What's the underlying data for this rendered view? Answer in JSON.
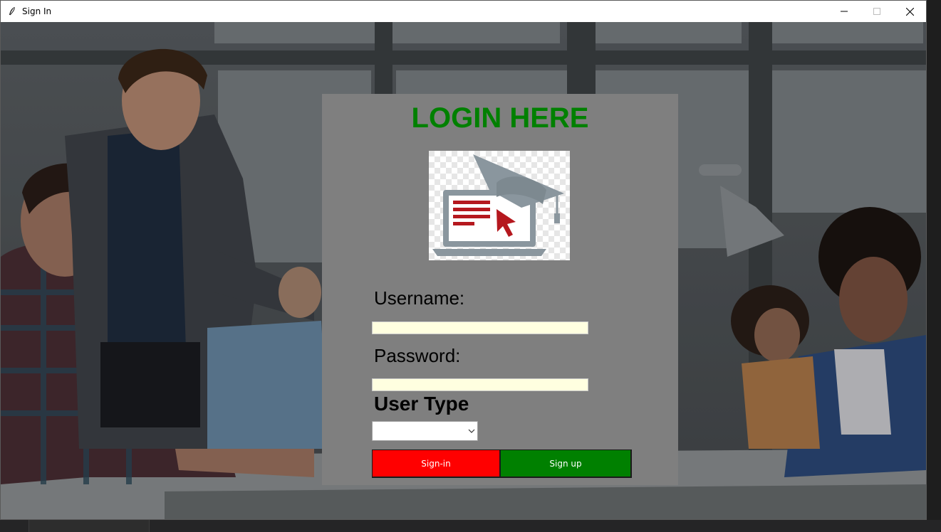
{
  "window": {
    "title": "Sign In"
  },
  "login": {
    "heading": "LOGIN HERE",
    "username_label": "Username:",
    "password_label": "Password:",
    "user_type_label": "User Type",
    "username_value": "",
    "password_value": "",
    "user_type_value": "",
    "signin_label": "Sign-in",
    "signup_label": "Sign up"
  },
  "colors": {
    "panel": "#7f7f7f",
    "heading": "#008000",
    "entry_bg": "#ffffe0",
    "signin_bg": "#ff0000",
    "signup_bg": "#008000",
    "logo_red": "#b5181e",
    "logo_gray": "#8a969e"
  },
  "icons": {
    "app": "feather-icon",
    "logo": "e-learning-laptop-graduation-cap-icon"
  }
}
